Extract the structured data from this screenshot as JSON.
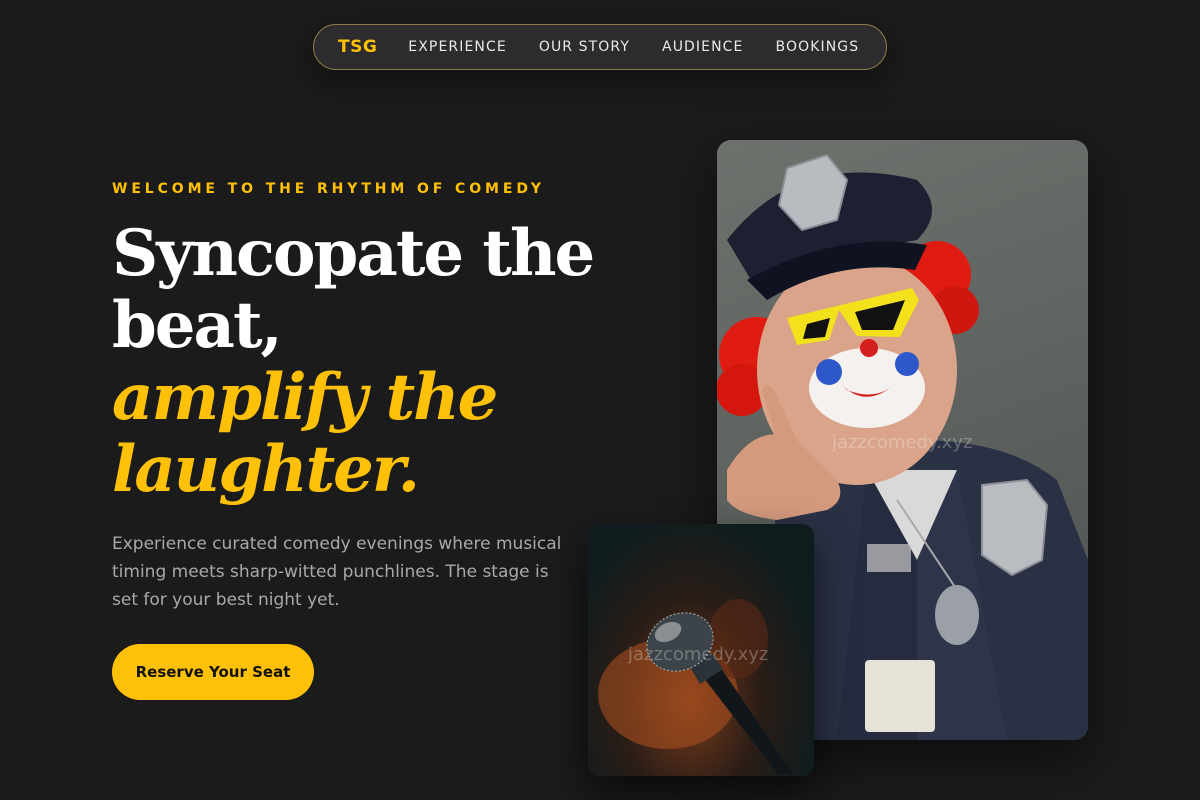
{
  "nav": {
    "logo": "TSG",
    "links": [
      "EXPERIENCE",
      "OUR STORY",
      "AUDIENCE",
      "BOOKINGS"
    ]
  },
  "hero": {
    "eyebrow": "WELCOME TO THE RHYTHM OF COMEDY",
    "headline_line1": "Syncopate the",
    "headline_line2": "beat,",
    "headline_accent_line1": "amplify the",
    "headline_accent_line2": "laughter.",
    "description": "Experience curated comedy evenings where musical timing meets sharp-witted punchlines. The stage is set for your best night yet.",
    "cta_label": "Reserve Your Seat"
  },
  "images": {
    "main_photo": {
      "icon": "clown-police-officer-photo",
      "watermark": "jazzcomedy.xyz"
    },
    "mic_photo": {
      "icon": "microphone-photo",
      "watermark": "jazzcomedy.xyz"
    }
  },
  "colors": {
    "background": "#1b1b1c",
    "accent": "#ffc107",
    "text": "#ffffff",
    "muted": "#a9a9ad"
  }
}
